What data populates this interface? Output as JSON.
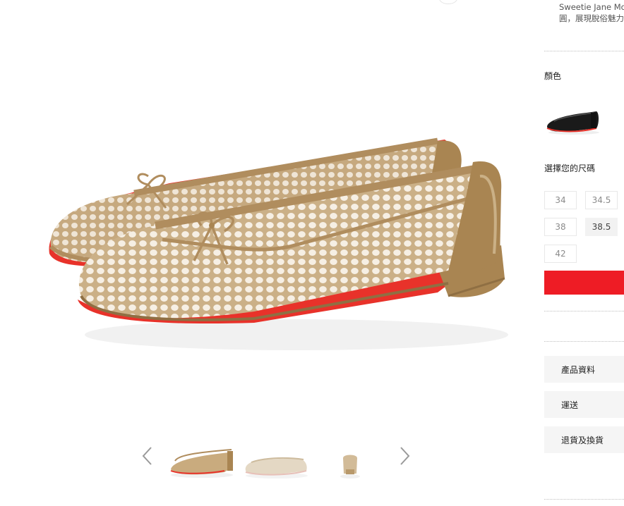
{
  "product": {
    "description_lines": [
      "Sweetie Jane Mo",
      "圓，展現脫俗魅力"
    ],
    "color_label": "顏色",
    "size_label": "選擇您的尺碼",
    "sizes": [
      {
        "label": "34",
        "selected": false
      },
      {
        "label": "34.5",
        "selected": false
      },
      {
        "label": "38",
        "selected": false
      },
      {
        "label": "38.5",
        "selected": true
      },
      {
        "label": "42",
        "selected": false
      }
    ],
    "add_to_cart_label": "",
    "accordion": [
      "產品資料",
      "運送",
      "退貨及換貨"
    ]
  },
  "gallery": {
    "prev_icon": "chevron-left-icon",
    "next_icon": "chevron-right-icon",
    "thumbnails": [
      "shoe-pair-side",
      "shoe-side-light",
      "shoe-heel-back"
    ]
  },
  "colors": {
    "accent": "#ee1c25",
    "leather": "#b08d5e",
    "mesh": "#d6b88c",
    "sole": "#e8322a"
  }
}
